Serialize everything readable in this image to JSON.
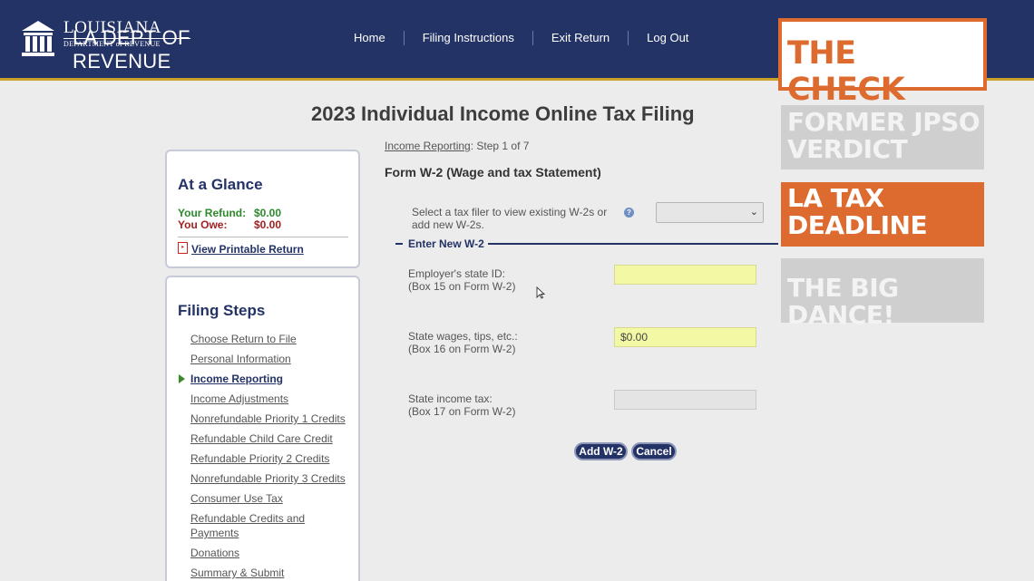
{
  "header": {
    "logo_name": "LOUISIANA",
    "logo_dept": "DEPARTMENT of REVENUE",
    "logo_overlay": "LA DEPT OF REVENUE",
    "nav": [
      "Home",
      "Filing Instructions",
      "Exit Return",
      "Log Out"
    ]
  },
  "page_title": "2023 Individual Income Online Tax Filing",
  "glance": {
    "title": "At a Glance",
    "refund_label": "Your Refund:",
    "refund_value": "$0.00",
    "owe_label": "You Owe:",
    "owe_value": "$0.00",
    "print_label": "View Printable Return"
  },
  "steps": {
    "title": "Filing Steps",
    "items": [
      "Choose Return to File",
      "Personal Information",
      "Income Reporting",
      "Income Adjustments",
      "Nonrefundable Priority 1 Credits",
      "Refundable Child Care Credit",
      "Refundable Priority 2 Credits",
      "Nonrefundable Priority 3 Credits",
      "Consumer Use Tax",
      "Refundable Credits and Payments",
      "Donations",
      "Summary & Submit"
    ],
    "current_index": 2
  },
  "breadcrumb": {
    "link": "Income Reporting",
    "step": ": Step 1 of 7"
  },
  "form": {
    "title": "Form W-2 (Wage and tax Statement)",
    "select_prompt": "Select a tax filer to view existing W-2s or add new W-2s.",
    "help_icon": "?",
    "section_label": "Enter New W-2",
    "employer_id_label": "Employer's state ID:",
    "employer_id_sub": "(Box 15 on Form W-2)",
    "employer_id_value": "",
    "wages_label": "State wages, tips, etc.:",
    "wages_sub": "(Box 16 on Form W-2)",
    "wages_value": "$0.00",
    "tax_label": "State income tax:",
    "tax_sub": "(Box 17 on Form W-2)",
    "tax_value": "",
    "add_button": "Add W-2",
    "cancel_button": "Cancel"
  },
  "overlay": {
    "check": "THE CHECK",
    "tile1": "FORMER JPSO VERDICT",
    "tile2": "LA TAX DEADLINE",
    "tile3": "THE BIG DANCE!"
  },
  "colors": {
    "header_bg": "#243366",
    "accent_orange": "#dd6a2e",
    "refund_green": "#2c8a2c",
    "owe_red": "#a12121",
    "input_yellow": "#f3f8a4"
  }
}
